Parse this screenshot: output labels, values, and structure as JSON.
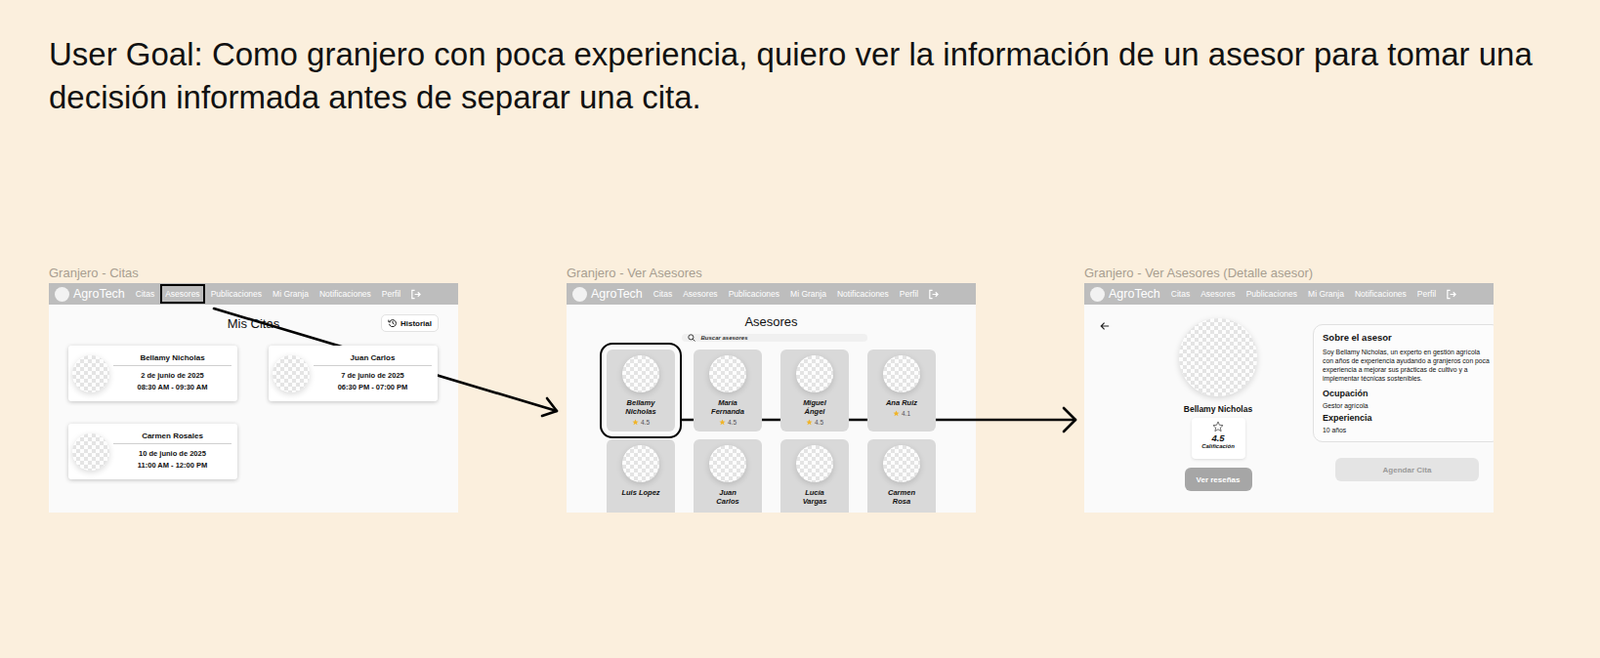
{
  "title": "User Goal: Como granjero con poca experiencia, quiero ver la información de un asesor para tomar una decisión informada antes de separar una cita.",
  "screens": [
    {
      "kind": "citas",
      "label": "Granjero - Citas",
      "logo": "AgroTech",
      "nav": [
        {
          "label": "Citas",
          "highlighted": false
        },
        {
          "label": "Asesores",
          "highlighted": true
        },
        {
          "label": "Publicaciones",
          "highlighted": false
        },
        {
          "label": "Mi Granja",
          "highlighted": false
        },
        {
          "label": "Notificaciones",
          "highlighted": false
        },
        {
          "label": "Perfil",
          "highlighted": false
        }
      ],
      "heading": "Mis Citas",
      "history_button": "Historial",
      "appointments": [
        {
          "name": "Bellamy Nicholas",
          "date": "2 de junio de 2025",
          "time": "08:30 AM - 09:30 AM"
        },
        {
          "name": "Juan Carlos",
          "date": "7 de junio de 2025",
          "time": "06:30 PM - 07:00 PM"
        },
        {
          "name": "Carmen Rosales",
          "date": "10 de junio de 2025",
          "time": "11:00 AM - 12:00 PM"
        }
      ]
    },
    {
      "kind": "asesores",
      "label": "Granjero - Ver Asesores",
      "logo": "AgroTech",
      "nav": [
        {
          "label": "Citas",
          "highlighted": false
        },
        {
          "label": "Asesores",
          "highlighted": false
        },
        {
          "label": "Publicaciones",
          "highlighted": false
        },
        {
          "label": "Mi Granja",
          "highlighted": false
        },
        {
          "label": "Notificaciones",
          "highlighted": false
        },
        {
          "label": "Perfil",
          "highlighted": false
        }
      ],
      "heading": "Asesores",
      "search_placeholder": "Buscar asesores",
      "advisors": [
        {
          "name": "Bellamy Nicholas",
          "rating": "4.5",
          "highlighted": true
        },
        {
          "name": "María Fernanda",
          "rating": "4.5",
          "highlighted": false
        },
        {
          "name": "Miguel Ángel",
          "rating": "4.5",
          "highlighted": false
        },
        {
          "name": "Ana Ruiz",
          "rating": "4.1",
          "highlighted": false
        },
        {
          "name": "Luis Lopez",
          "highlighted": false
        },
        {
          "name": "Juan Carlos",
          "highlighted": false
        },
        {
          "name": "Lucía Vargas",
          "highlighted": false
        },
        {
          "name": "Carmen Rosa",
          "highlighted": false
        }
      ]
    },
    {
      "kind": "detalle",
      "label": "Granjero - Ver Asesores (Detalle asesor)",
      "logo": "AgroTech",
      "nav": [
        {
          "label": "Citas",
          "highlighted": false
        },
        {
          "label": "Asesores",
          "highlighted": false
        },
        {
          "label": "Publicaciones",
          "highlighted": false
        },
        {
          "label": "Mi Granja",
          "highlighted": false
        },
        {
          "label": "Notificaciones",
          "highlighted": false
        },
        {
          "label": "Perfil",
          "highlighted": false
        }
      ],
      "name": "Bellamy Nicholas",
      "rating": "4.5",
      "rating_label": "Calificación",
      "reviews_button": "Ver reseñas",
      "about_title": "Sobre el asesor",
      "about_text": "Soy Bellamy Nicholas, un experto en gestión agrícola con años de experiencia ayudando a granjeros con poca experiencia a mejorar sus prácticas de cultivo y a implementar técnicas sostenibles.",
      "occupation_label": "Ocupación",
      "occupation": "Gestor agrícola",
      "experience_label": "Experiencia",
      "experience": "10 años",
      "schedule_button": {
        "label": "Agendar Cita",
        "disabled": true
      }
    }
  ]
}
